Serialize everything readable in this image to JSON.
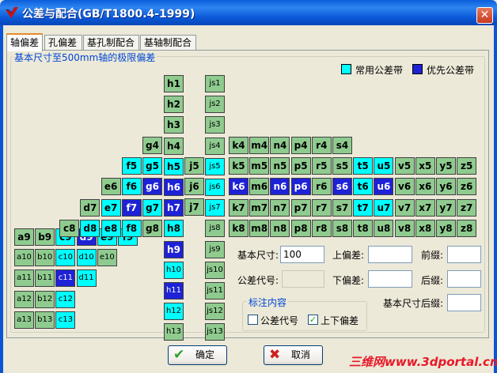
{
  "window": {
    "title": "公差与配合(GB/T1800.4-1999)",
    "close_glyph": "✕"
  },
  "tabs": [
    "轴偏差",
    "孔偏差",
    "基孔制配合",
    "基轴制配合"
  ],
  "group_title": "基本尺寸至500mm轴的极限偏差",
  "colors": {
    "common": "#00FFFF",
    "preferred": "#1E22D6",
    "normal": "#8FCB8F"
  },
  "legend": {
    "common_label": "常用公差带",
    "preferred_label": "优先公差带"
  },
  "grid": {
    "h": [
      [
        "a9",
        "b9",
        "c9",
        "d9",
        "e9",
        "f9"
      ],
      [
        "a10",
        "b10",
        "c10",
        "d10",
        "e10"
      ],
      [
        "a11",
        "b11",
        "c11",
        "d11"
      ],
      [
        "a12",
        "b12",
        "c12"
      ],
      [
        "a13",
        "b13",
        "c13"
      ]
    ],
    "r": [
      [
        "h1",
        "h2",
        "h3",
        "h4",
        "h5",
        "h6",
        "h7",
        "h8",
        "h9",
        "h10",
        "h11",
        "h12",
        "h13"
      ],
      [
        "js1",
        "js2",
        "js3",
        "js4",
        "js5",
        "js6",
        "js7",
        "js8",
        "js9",
        "js10",
        "js11",
        "js12",
        "js13"
      ]
    ],
    "g": [
      [
        "g4",
        "g5",
        "g6",
        "g7",
        "g8"
      ],
      [
        "f5",
        "f6",
        "f7",
        "f8"
      ],
      [
        "e6",
        "e7",
        "e8"
      ],
      [
        "d7",
        "d8"
      ],
      [
        "c8"
      ]
    ],
    "j": [
      "j5",
      "j6",
      "j7"
    ],
    "k": [
      [
        "k4",
        "m4",
        "n4",
        "p4",
        "r4",
        "s4"
      ],
      [
        "k5",
        "m5",
        "n5",
        "p5",
        "r5",
        "s5",
        "t5",
        "u5",
        "v5",
        "x5",
        "y5",
        "z5"
      ],
      [
        "k6",
        "m6",
        "n6",
        "p6",
        "r6",
        "s6",
        "t6",
        "u6",
        "v6",
        "x6",
        "y6",
        "z6"
      ],
      [
        "k7",
        "m7",
        "n7",
        "p7",
        "r7",
        "s7",
        "t7",
        "u7",
        "v7",
        "x7",
        "y7",
        "z7"
      ],
      [
        "k8",
        "m8",
        "n8",
        "p8",
        "r8",
        "s8",
        "t8",
        "u8",
        "v8",
        "x8",
        "y8",
        "z8"
      ]
    ],
    "common": [
      "c9",
      "c10",
      "c11",
      "c12",
      "c13",
      "d8",
      "d10",
      "d11",
      "e7",
      "e8",
      "e9",
      "f5",
      "f6",
      "f8",
      "f9",
      "g5",
      "g7",
      "h5",
      "h8",
      "h10",
      "h12",
      "js5",
      "js6",
      "js7",
      "t5",
      "t6",
      "t7",
      "u5",
      "u7"
    ],
    "preferred": [
      "c11",
      "d9",
      "f7",
      "g6",
      "h6",
      "h7",
      "h9",
      "h11",
      "k6",
      "n6",
      "p6",
      "s6",
      "u6"
    ]
  },
  "form": {
    "basic_size_label": "基本尺寸:",
    "basic_size_value": "100",
    "upper_dev_label": "上偏差:",
    "upper_dev_value": "",
    "prefix_label": "前缀:",
    "prefix_value": "",
    "tol_code_label": "公差代号:",
    "tol_code_value": "",
    "lower_dev_label": "下偏差:",
    "lower_dev_value": "",
    "suffix_label": "后缀:",
    "suffix_value": "",
    "size_suffix_label": "基本尺寸后缀:",
    "size_suffix_value": ""
  },
  "annotation": {
    "title": "标注内容",
    "tol_code": {
      "label": "公差代号",
      "checked": false
    },
    "deviation": {
      "label": "上下偏差",
      "checked": true
    }
  },
  "buttons": {
    "ok": "确定",
    "cancel": "取消"
  },
  "watermark": "三维网www.3dportal.cn"
}
